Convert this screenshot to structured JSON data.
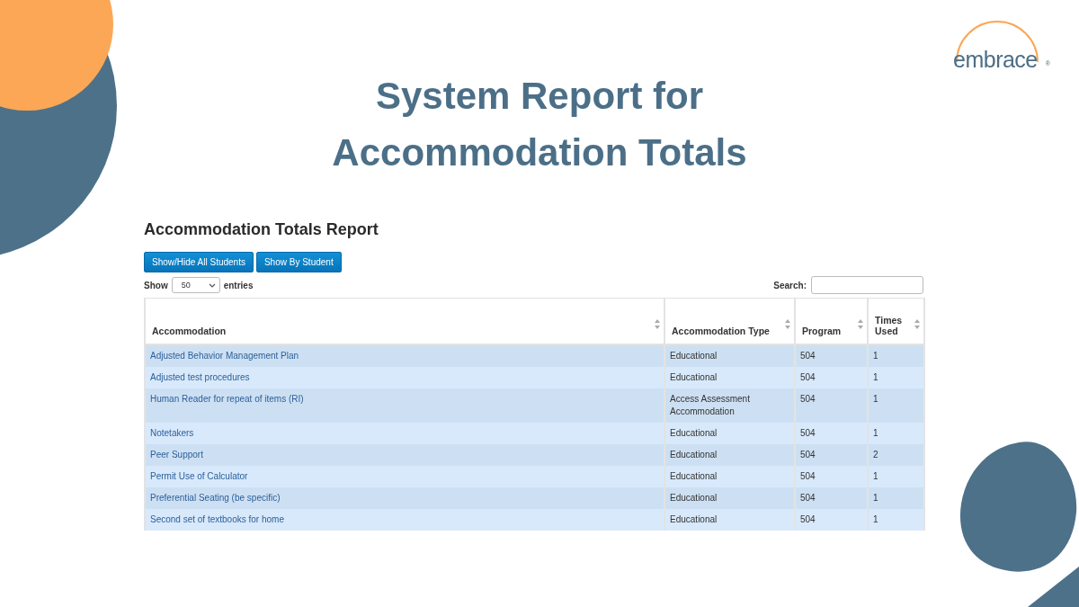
{
  "logo": {
    "text": "embrace",
    "mark": "®"
  },
  "title": [
    "System Report for",
    "Accommodation Totals"
  ],
  "report": {
    "heading": "Accommodation Totals Report",
    "buttons": [
      "Show/Hide All Students",
      "Show By Student"
    ],
    "length": {
      "before": "Show",
      "value": "50",
      "after": "entries"
    },
    "search": {
      "label": "Search:"
    },
    "columns": [
      "Accommodation",
      "Accommodation Type",
      "Program",
      "Times Used"
    ],
    "rows": [
      {
        "cells": [
          "Adjusted Behavior Management Plan",
          "Educational",
          "504",
          "1"
        ]
      },
      {
        "cells": [
          "Adjusted test procedures",
          "Educational",
          "504",
          "1"
        ]
      },
      {
        "cells": [
          "Human Reader for repeat of items (RI)",
          "Access Assessment Accommodation",
          "504",
          "1"
        ]
      },
      {
        "cells": [
          "Notetakers",
          "Educational",
          "504",
          "1"
        ]
      },
      {
        "cells": [
          "Peer Support",
          "Educational",
          "504",
          "2"
        ]
      },
      {
        "cells": [
          "Permit Use of Calculator",
          "Educational",
          "504",
          "1"
        ]
      },
      {
        "cells": [
          "Preferential Seating (be specific)",
          "Educational",
          "504",
          "1"
        ]
      },
      {
        "cells": [
          "Second set of textbooks for home",
          "Educational",
          "504",
          "1"
        ]
      }
    ]
  }
}
